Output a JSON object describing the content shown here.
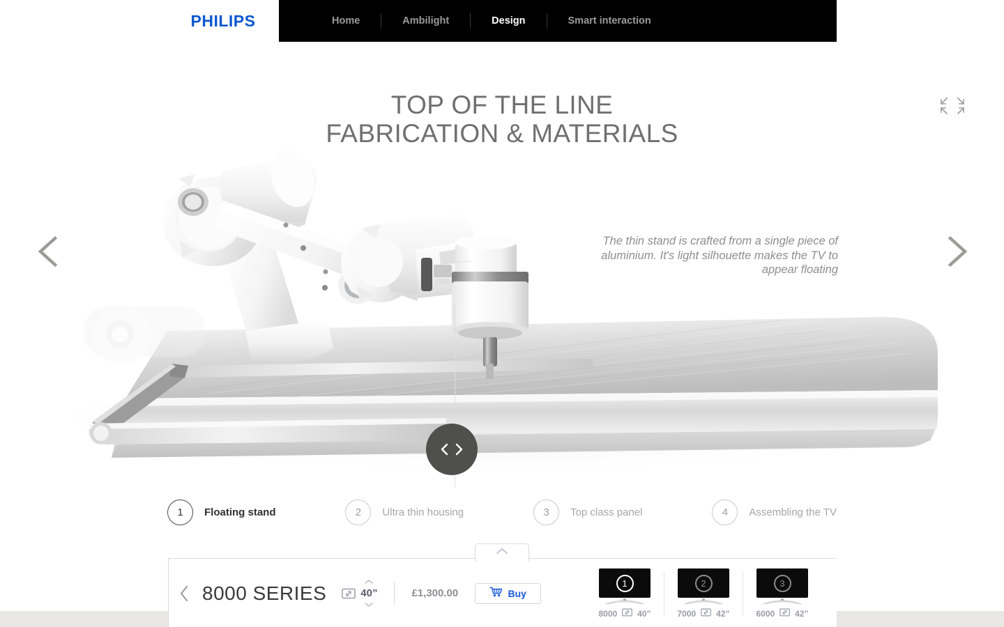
{
  "brand": {
    "logo_text": "PHILIPS",
    "logo_color": "#0b57d0"
  },
  "nav": {
    "items": [
      {
        "label": "Home",
        "active": false
      },
      {
        "label": "Ambilight",
        "active": false
      },
      {
        "label": "Design",
        "active": true
      },
      {
        "label": "Smart interaction",
        "active": false
      }
    ]
  },
  "hero": {
    "title_line1": "TOP OF THE LINE",
    "title_line2": "FABRICATION & MATERIALS",
    "caption": "The thin stand is crafted from a single piece of aluminium. It's light silhouette makes the TV to appear floating",
    "expand_icon": "fullscreen-expand-icon",
    "prev_icon": "chevron-left-icon",
    "next_icon": "chevron-right-icon",
    "compare_prev_icon": "chevron-left-icon",
    "compare_next_icon": "chevron-right-icon"
  },
  "steps": [
    {
      "num": "1",
      "label": "Floating stand",
      "active": true
    },
    {
      "num": "2",
      "label": "Ultra thin housing",
      "active": false
    },
    {
      "num": "3",
      "label": "Top class panel",
      "active": false
    },
    {
      "num": "4",
      "label": "Assembling the TV",
      "active": false
    }
  ],
  "bottom_bar": {
    "collapse_icon": "chevron-up-icon",
    "prev_icon": "chevron-left-icon",
    "next_icon": "chevron-right-icon",
    "product_name": "8000 SERIES",
    "size_icon": "screen-size-icon",
    "size_value": "40”",
    "stepper_up_icon": "chevron-up-icon",
    "stepper_down_icon": "chevron-down-icon",
    "price": "£1,300.00",
    "buy_label": "Buy",
    "buy_icon": "shopping-cart-icon",
    "buy_color": "#1859d8"
  },
  "thumbnails": [
    {
      "badge": "1",
      "series": "8000",
      "size": "40”",
      "size_icon": "screen-size-icon",
      "active": true
    },
    {
      "badge": "2",
      "series": "7000",
      "size": "42”",
      "size_icon": "screen-size-icon",
      "active": false
    },
    {
      "badge": "3",
      "series": "6000",
      "size": "42”",
      "size_icon": "screen-size-icon",
      "active": false
    }
  ]
}
